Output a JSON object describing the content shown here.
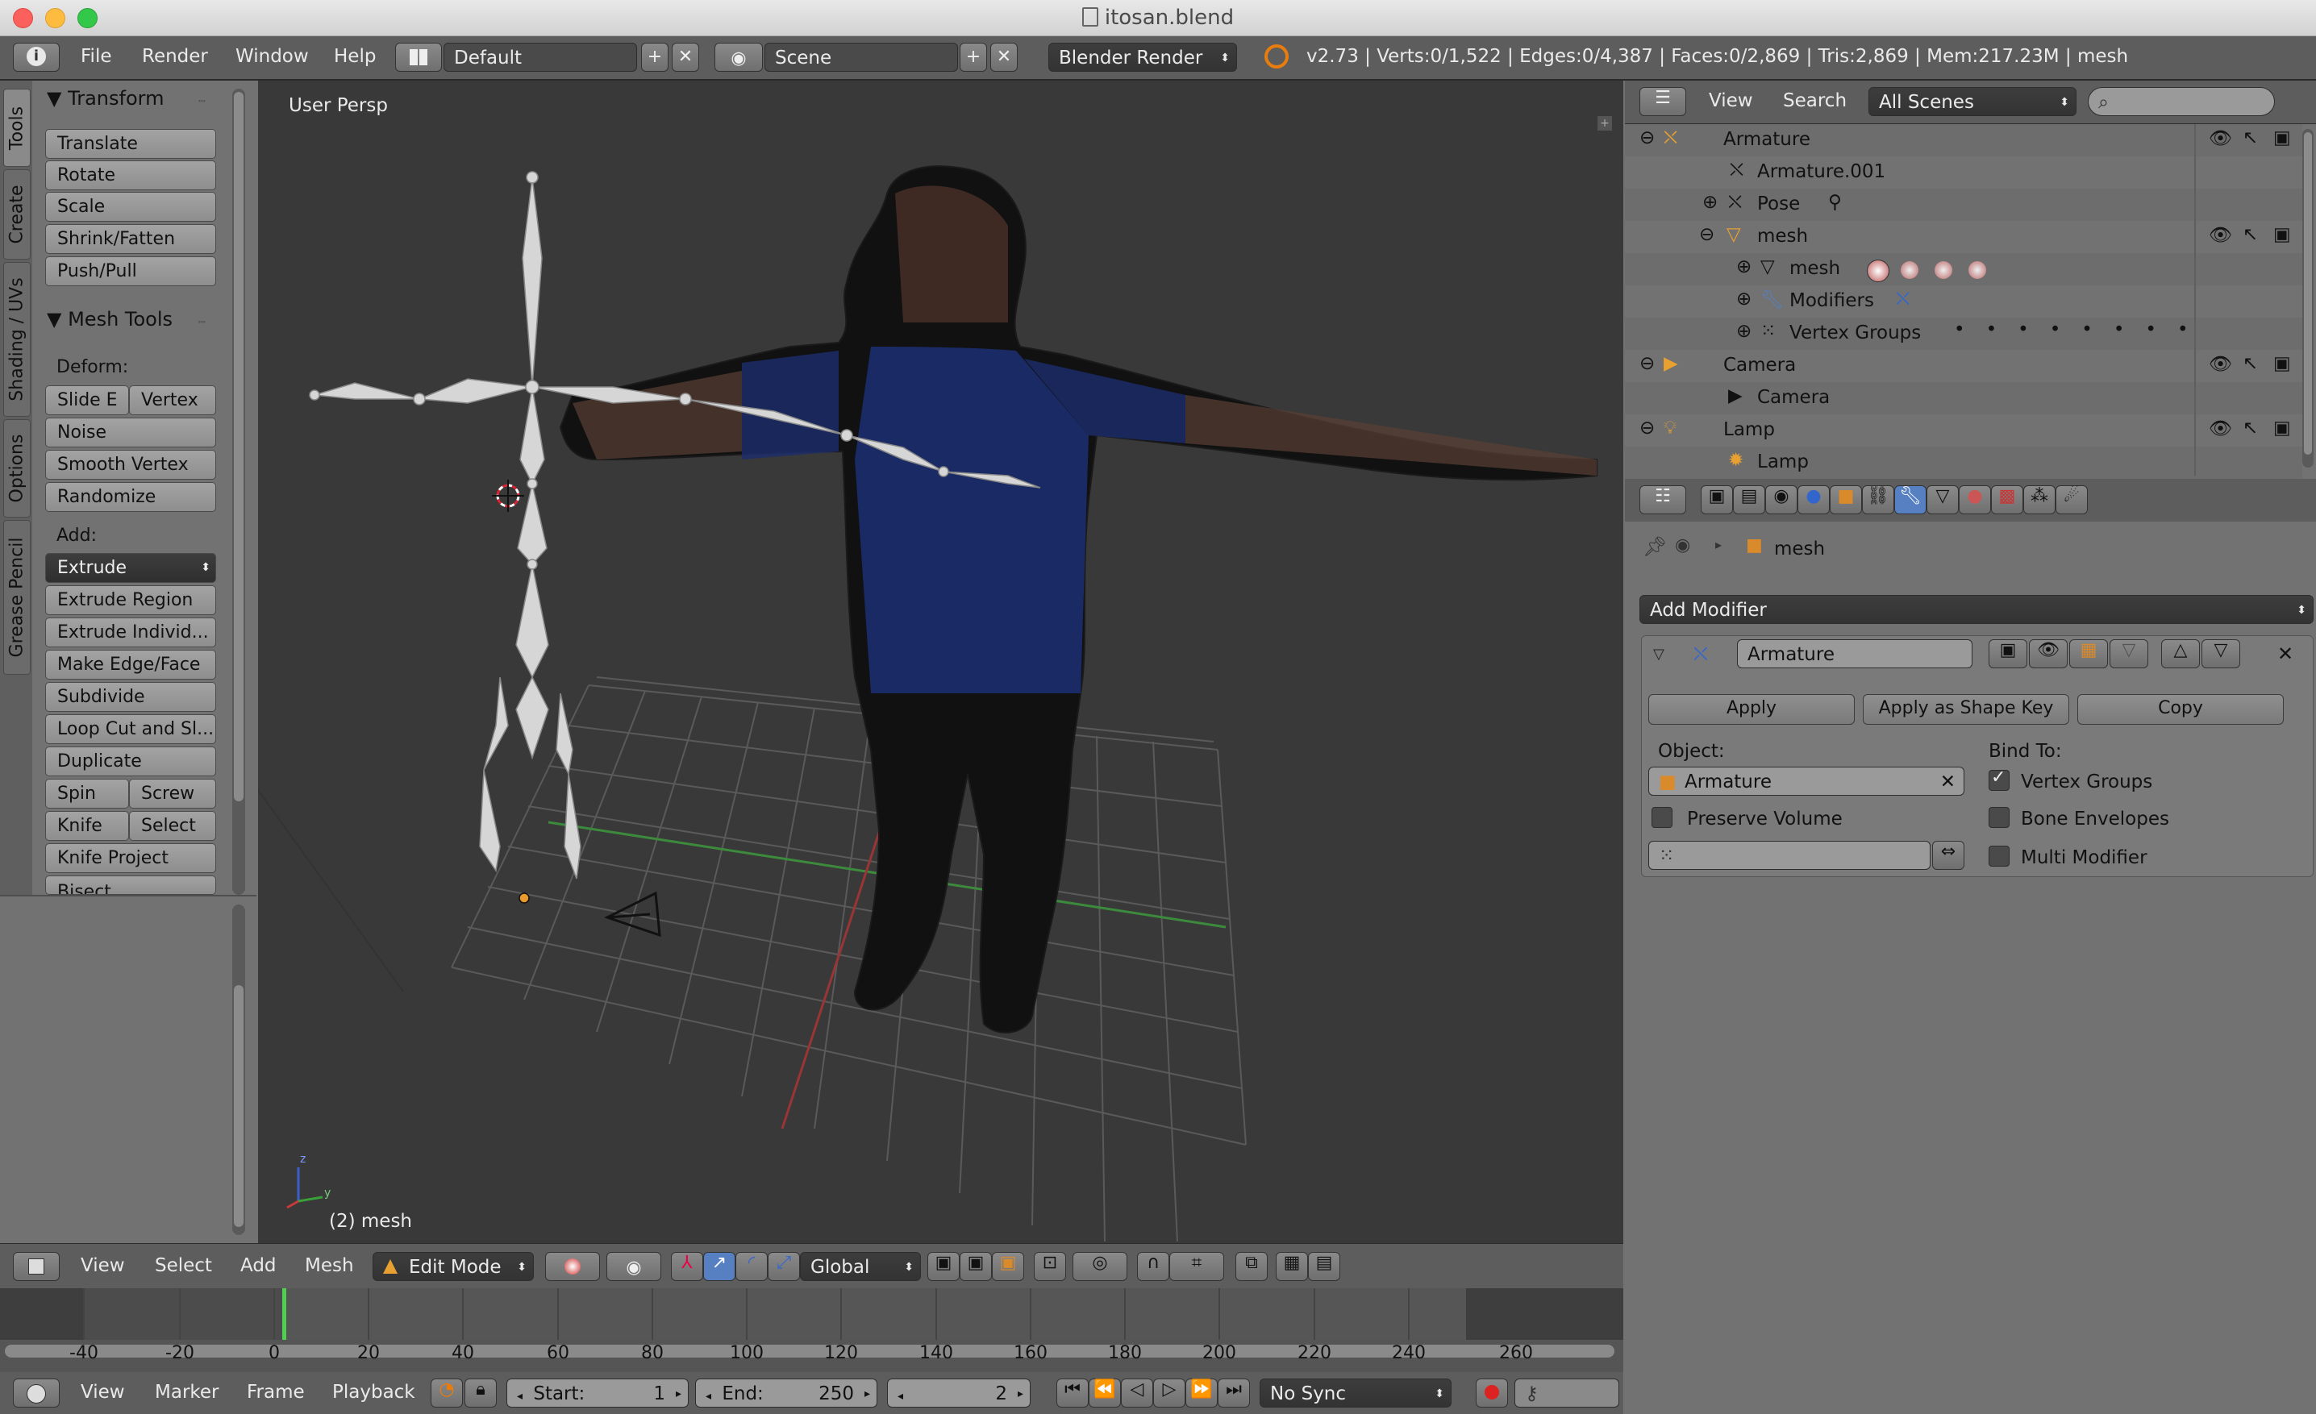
{
  "window": {
    "title": "itosan.blend"
  },
  "info": {
    "menus": [
      "File",
      "Render",
      "Window",
      "Help"
    ],
    "screen_layout": "Default",
    "scene": "Scene",
    "render_engine": "Blender Render",
    "stats": "v2.73 | Verts:0/1,522 | Edges:0/4,387 | Faces:0/2,869 | Tris:2,869 | Mem:217.23M | mesh"
  },
  "toolshelf": {
    "tabs": [
      "Tools",
      "Create",
      "Shading / UVs",
      "Options",
      "Grease Pencil"
    ],
    "transform_title": "Transform",
    "transform_buttons": [
      "Translate",
      "Rotate",
      "Scale",
      "Shrink/Fatten",
      "Push/Pull"
    ],
    "mesh_tools_title": "Mesh Tools",
    "deform_label": "Deform:",
    "slide_edge": "Slide E",
    "vertex": "Vertex",
    "deform_buttons": [
      "Noise",
      "Smooth Vertex",
      "Randomize"
    ],
    "add_label": "Add:",
    "extrude": "Extrude",
    "add_buttons": [
      "Extrude Region",
      "Extrude Individ...",
      "Make Edge/Face",
      "Subdivide",
      "Loop Cut and Sl...",
      "Duplicate"
    ],
    "spin": "Spin",
    "screw": "Screw",
    "knife": "Knife",
    "select": "Select",
    "knife_project": "Knife Project",
    "bisect": "Bisect"
  },
  "viewport": {
    "view_name": "User Persp",
    "object_label": "(2) mesh",
    "axis_z": "z",
    "axis_y": "y"
  },
  "view3d_header": {
    "menus": [
      "View",
      "Select",
      "Add",
      "Mesh"
    ],
    "mode": "Edit Mode",
    "orientation": "Global"
  },
  "timeline": {
    "ticks": [
      "-40",
      "-20",
      "0",
      "20",
      "40",
      "60",
      "80",
      "100",
      "120",
      "140",
      "160",
      "180",
      "200",
      "220",
      "240",
      "260"
    ],
    "current_frame_value": 2,
    "menus": [
      "View",
      "Marker",
      "Frame",
      "Playback"
    ],
    "start_label": "Start:",
    "start_value": "1",
    "end_label": "End:",
    "end_value": "250",
    "current_frame": "2",
    "sync": "No Sync"
  },
  "outliner": {
    "menus": [
      "View",
      "Search"
    ],
    "filter": "All Scenes",
    "search_placeholder": "",
    "items": [
      "Armature",
      "Armature.001",
      "Pose",
      "mesh",
      "mesh",
      "Modifiers",
      "Vertex Groups",
      "Camera",
      "Camera",
      "Lamp",
      "Lamp"
    ]
  },
  "properties": {
    "breadcrumb": "mesh",
    "add_modifier": "Add Modifier",
    "modifier_name": "Armature",
    "apply": "Apply",
    "apply_shape_key": "Apply as Shape Key",
    "copy": "Copy",
    "object_label": "Object:",
    "object_value": "Armature",
    "bind_to_label": "Bind To:",
    "vertex_groups": "Vertex Groups",
    "vertex_groups_checked": true,
    "preserve_volume": "Preserve Volume",
    "bone_envelopes": "Bone Envelopes",
    "multi_modifier": "Multi Modifier"
  },
  "colors": {
    "accent": "#5680c2",
    "frame_cursor": "#50d050",
    "viewport_bg": "#393939",
    "panel_bg": "#727272"
  }
}
